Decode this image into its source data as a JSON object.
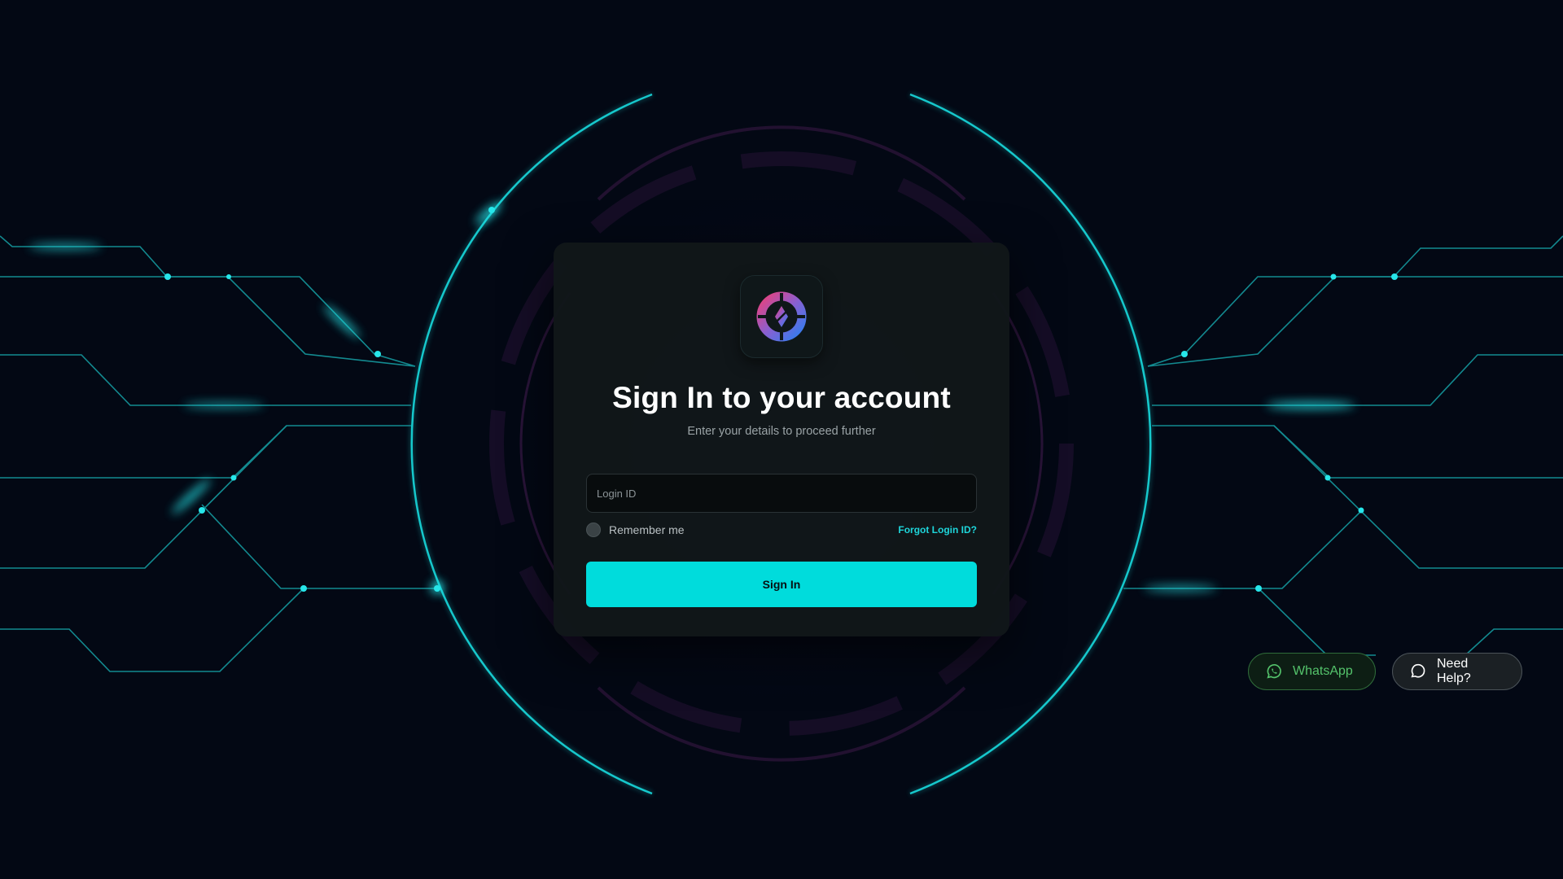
{
  "login": {
    "title": "Sign In to your account",
    "subtitle": "Enter your details to proceed further",
    "login_id_placeholder": "Login ID",
    "login_id_value": "",
    "remember_label": "Remember me",
    "forgot_label": "Forgot Login ID?",
    "signin_label": "Sign In",
    "logo_icon": "compass-logo-icon"
  },
  "floating": {
    "whatsapp_label": "WhatsApp",
    "whatsapp_icon": "whatsapp-icon",
    "help_label": "Need Help?",
    "help_icon": "chat-bubble-icon"
  },
  "colors": {
    "background": "#030814",
    "accent": "#00dcdc",
    "card": "#111719",
    "whatsapp_green": "#54c36b"
  }
}
